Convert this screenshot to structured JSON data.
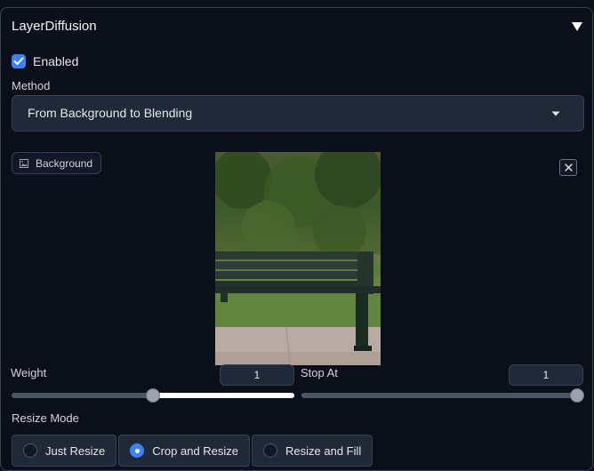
{
  "accordion": {
    "title": "LayerDiffusion",
    "toggle_icon": "triangle-down-icon"
  },
  "enabled": {
    "label": "Enabled",
    "checked": true
  },
  "method": {
    "label": "Method",
    "value": "From Background to Blending"
  },
  "image": {
    "tag_label": "Background",
    "tag_icon": "image-icon",
    "close_icon": "close-icon"
  },
  "weight": {
    "label": "Weight",
    "value": "1",
    "level": 0.5
  },
  "stop_at": {
    "label": "Stop At",
    "value": "1",
    "level": 1.0
  },
  "resize_mode": {
    "label": "Resize Mode",
    "options": [
      "Just Resize",
      "Crop and Resize",
      "Resize and Fill"
    ],
    "selected": "Crop and Resize"
  },
  "colors": {
    "accent": "#3b82f6",
    "background": "#0b0f19",
    "input": "#1f2937",
    "border": "#374151"
  }
}
